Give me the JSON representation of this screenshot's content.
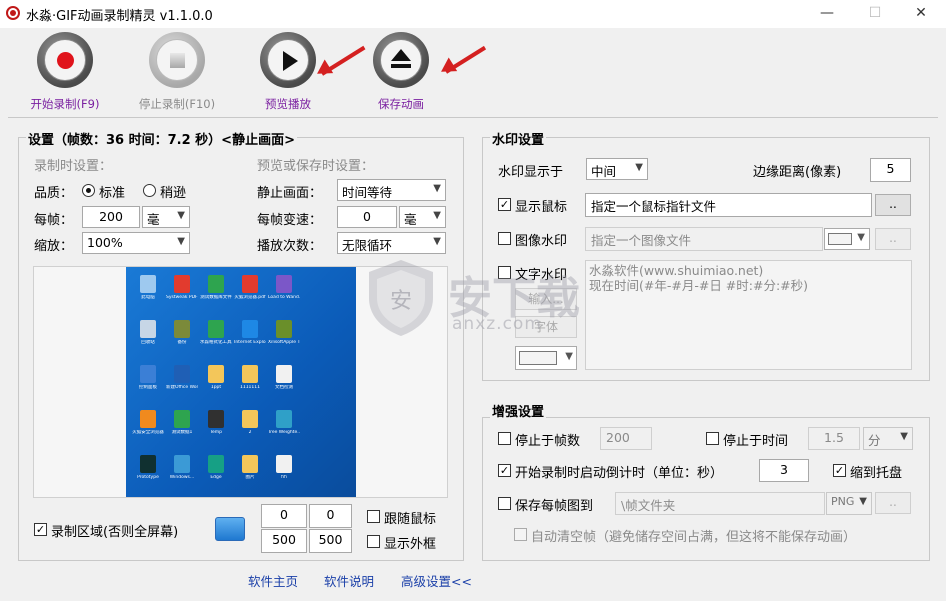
{
  "titlebar": {
    "title": "水淼·GIF动画录制精灵 v1.1.0.0",
    "minimize": "—",
    "maximize": "☐",
    "close": "✕"
  },
  "toolbar": {
    "start": "开始录制(F9)",
    "stop": "停止录制(F10)",
    "preview": "预览播放",
    "save": "保存动画",
    "accent": "#7a1fa0"
  },
  "settings": {
    "title": "设置（帧数：36 时间：7.2 秒）<静止画面>",
    "record_header": "录制时设置：",
    "playback_header": "预览或保存时设置：",
    "quality_label": "品质：",
    "quality_standard": "标准",
    "quality_fine": "稍逊",
    "per_frame_label": "每帧：",
    "per_frame_value": "200",
    "per_frame_unit": "毫",
    "scale_label": "缩放：",
    "scale_value": "100%",
    "still_label": "静止画面：",
    "still_value": "时间等待",
    "frame_speed_label": "每帧变速：",
    "frame_speed_value": "0",
    "frame_speed_unit": "毫",
    "loop_label": "播放次数：",
    "loop_value": "无限循环"
  },
  "desktop_icons": [
    {
      "label": "此电脑",
      "color": "#9ec9ef"
    },
    {
      "label": "Systweak PDF Write...",
      "color": "#e23b2e"
    },
    {
      "label": "测试数据库文件",
      "color": "#2ea44f"
    },
    {
      "label": "火狐浏览器.pdf",
      "color": "#e23b2e"
    },
    {
      "label": "Load to Wand...",
      "color": "#7b57c8"
    },
    {
      "label": "回收站",
      "color": "#c7d6e6"
    },
    {
      "label": "备份",
      "color": "#7b8a3a"
    },
    {
      "label": "水淼格式化工具3",
      "color": "#2ea44f"
    },
    {
      "label": "Internet Explorer",
      "color": "#1e88e5"
    },
    {
      "label": "XilisoftApple TV",
      "color": "#6a8f2a"
    },
    {
      "label": "控制面板",
      "color": "#3b7fd6"
    },
    {
      "label": "新建Office Word",
      "color": "#1f5fb5"
    },
    {
      "label": "1ppt",
      "color": "#f3c65a"
    },
    {
      "label": "1111111",
      "color": "#f3c65a"
    },
    {
      "label": "文档检测",
      "color": "#f1f1f1"
    },
    {
      "label": "火狐安全浏览器",
      "color": "#f08a1e"
    },
    {
      "label": "测试数据1",
      "color": "#2ea44f"
    },
    {
      "label": "Temp",
      "color": "#303030"
    },
    {
      "label": "2",
      "color": "#f3c65a"
    },
    {
      "label": "Tree Weighte...",
      "color": "#2fa0c8"
    },
    {
      "label": "Prototype",
      "color": "#103030"
    },
    {
      "label": "Windows...",
      "color": "#3b9ad6"
    },
    {
      "label": "Edge",
      "color": "#16a085"
    },
    {
      "label": "图片",
      "color": "#f3c65a"
    },
    {
      "label": "fifi",
      "color": "#f1f1f1"
    }
  ],
  "region": {
    "checkbox_label": "录制区域(否则全屏幕)",
    "x": "0",
    "y": "0",
    "w": "500",
    "h": "500",
    "follow_mouse": "跟随鼠标",
    "show_frame": "显示外框"
  },
  "watermark": {
    "title": "水印设置",
    "show_at_label": "水印显示于",
    "show_at_value": "中间",
    "margin_label": "边缘距离(像素)",
    "margin_value": "5",
    "show_mouse_label": "显示鼠标",
    "mouse_file_value": "指定一个鼠标指针文件",
    "image_label": "图像水印",
    "image_placeholder": "指定一个图像文件",
    "text_label": "文字水印",
    "text_value_line1": "水淼软件(www.shuimiao.net)",
    "text_value_line2": "现在时间(#年-#月-#日 #时:#分:#秒)",
    "input_btn": "输入...",
    "font_btn": "字体",
    "browse": ".."
  },
  "enhance": {
    "title": "增强设置",
    "stop_frames_label": "停止于帧数",
    "stop_frames_value": "200",
    "stop_time_label": "停止于时间",
    "stop_time_value": "1.5",
    "stop_time_unit": "分",
    "countdown_label": "开始录制时启动倒计时（单位：秒）",
    "countdown_value": "3",
    "tray_label": "缩到托盘",
    "save_each_label": "保存每帧图到",
    "save_each_path": "\\帧文件夹",
    "save_each_format": "PNG",
    "auto_clear_label": "自动清空帧（避免储存空间占满，但这将不能保存动画）",
    "browse": ".."
  },
  "footer": {
    "home": "软件主页",
    "help": "软件说明",
    "advanced": "高级设置<<"
  },
  "site_watermark": {
    "text": "安下载",
    "sub": "anxz.com"
  }
}
